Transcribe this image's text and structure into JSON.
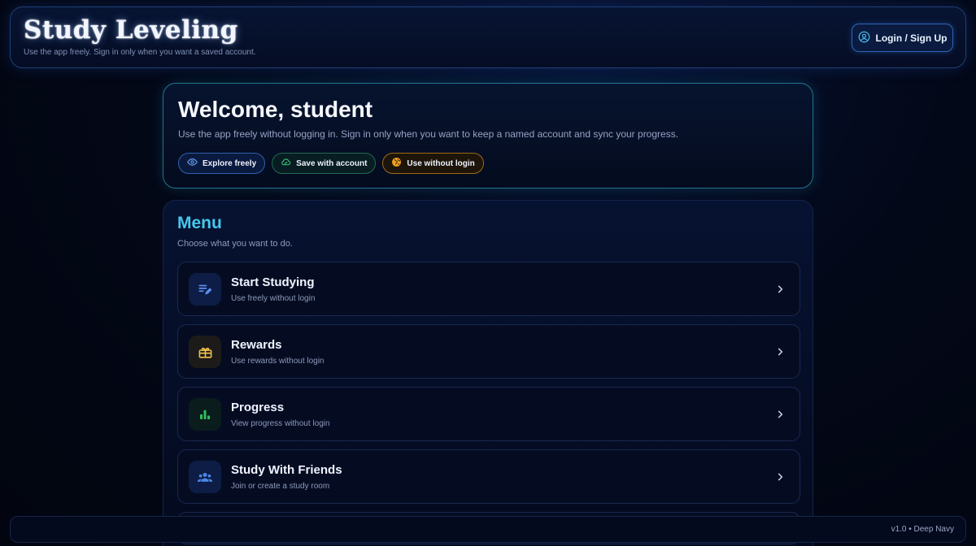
{
  "header": {
    "brand": "Study Leveling",
    "subtitle": "Use the app freely. Sign in only when you want a saved account.",
    "login_label": "Login / Sign Up",
    "login_icon": "account-circle-icon"
  },
  "welcome": {
    "title": "Welcome, student",
    "subtitle": "Use the app freely without logging in. Sign in only when you want to keep a named account and sync your progress.",
    "pills": [
      {
        "label": "Explore freely",
        "icon": "eye-icon",
        "color": "#6ea8ff"
      },
      {
        "label": "Save with account",
        "icon": "cloud-icon",
        "color": "#34c77b"
      },
      {
        "label": "Use without login",
        "icon": "globe-icon",
        "color": "#f0a020"
      }
    ]
  },
  "menu": {
    "title": "Menu",
    "subtitle": "Choose what you want to do.",
    "items": [
      {
        "title": "Start Studying",
        "subtitle": "Use freely without login",
        "icon": "edit-notes-icon",
        "color": "#5b8ef0"
      },
      {
        "title": "Rewards",
        "subtitle": "Use rewards without login",
        "icon": "gift-icon",
        "color": "#f2c04a"
      },
      {
        "title": "Progress",
        "subtitle": "View progress without login",
        "icon": "bar-chart-icon",
        "color": "#2fbf5d"
      },
      {
        "title": "Study With Friends",
        "subtitle": "Join or create a study room",
        "icon": "group-icon",
        "color": "#4a86e8"
      }
    ]
  },
  "footer": {
    "version": "v1.0 • Deep Navy"
  }
}
